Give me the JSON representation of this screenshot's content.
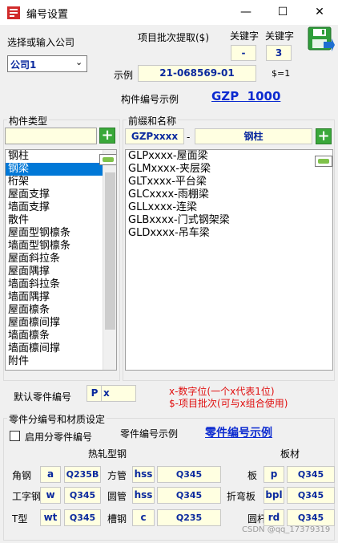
{
  "window": {
    "title": "编号设置",
    "min": "—",
    "max": "☐",
    "close": "✕"
  },
  "company": {
    "label": "选择或输入公司",
    "value": "公司1"
  },
  "batch": {
    "label": "项目批次提取($)"
  },
  "keyword1": {
    "label": "关键字",
    "value": "-"
  },
  "keyword2": {
    "label": "关键字",
    "value": "3"
  },
  "example": {
    "label": "示例",
    "value": "21-068569-01",
    "var": "$=1"
  },
  "component_example": {
    "label": "构件编号示例",
    "value": "GZP  1000"
  },
  "types": {
    "group": "构件类型",
    "items": [
      "钢柱",
      "钢梁",
      "桁架",
      "屋面支撑",
      "墙面支撑",
      "散件",
      "屋面型钢檩条",
      "墙面型钢檩条",
      "屋面斜拉条",
      "屋面隅撑",
      "墙面斜拉条",
      "墙面隅撑",
      "屋面檩条",
      "屋面檩间撑",
      "墙面檩条",
      "墙面檩间撑",
      "附件"
    ],
    "selected_index": 1
  },
  "prefix": {
    "group": "前缀和名称",
    "prefix_value": "GZPxxxx",
    "dash": "-",
    "name_value": "钢柱",
    "items": [
      "GLPxxxx-屋面梁",
      "GLMxxxx-夹层梁",
      "GLTxxxx-平台梁",
      "GLCxxxx-雨棚梁",
      "GLLxxxx-连梁",
      "GLBxxxx-门式钢架梁",
      "GLDxxxx-吊车梁"
    ]
  },
  "default_part": {
    "label": "默认零件编号",
    "v1": "P",
    "v2": "x"
  },
  "notes": {
    "line1": "x-数字位(一个x代表1位)",
    "line2": "$-项目批次(可与x组合使用)"
  },
  "part_section": {
    "group": "零件分编号和材质设定",
    "checkbox": "启用分零件编号",
    "example_label": "零件编号示例",
    "example_value": "零件编号示例",
    "hot_rolled": "热轧型钢",
    "plate": "板材",
    "rows": [
      [
        {
          "label": "角钢",
          "code": "a",
          "mat": "Q235B"
        },
        {
          "label": "方管",
          "code": "hss",
          "mat": "Q345"
        },
        {
          "label": "板",
          "code": "p",
          "mat": "Q345"
        }
      ],
      [
        {
          "label": "工字钢",
          "code": "w",
          "mat": "Q345"
        },
        {
          "label": "圆管",
          "code": "hss",
          "mat": "Q345"
        },
        {
          "label": "折弯板",
          "code": "bpl",
          "mat": "Q345"
        }
      ],
      [
        {
          "label": "T型",
          "code": "wt",
          "mat": "Q345"
        },
        {
          "label": "槽钢",
          "code": "c",
          "mat": "Q235"
        },
        {
          "label": "圆杆",
          "code": "rd",
          "mat": "Q345"
        }
      ]
    ]
  },
  "watermark": "CSDN @qq_17379319"
}
